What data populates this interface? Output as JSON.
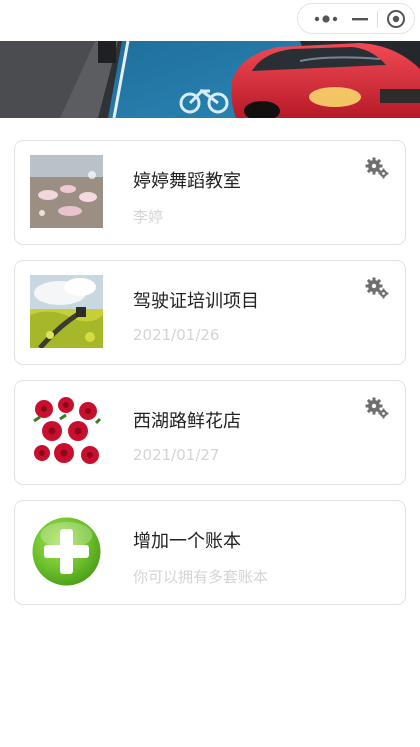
{
  "capsule": {
    "more_icon": "more-dots-icon",
    "minimize_icon": "minimize-icon",
    "close_icon": "target-close-icon"
  },
  "banner": {
    "description_icon": "street-car-photo"
  },
  "accounts": [
    {
      "title": "婷婷舞蹈教室",
      "subtitle": "李婷",
      "thumb_icon": "dance-class-photo",
      "settings_icon": "gears-icon"
    },
    {
      "title": "驾驶证培训项目",
      "subtitle": "2021/01/26",
      "thumb_icon": "train-field-photo",
      "settings_icon": "gears-icon"
    },
    {
      "title": "西湖路鲜花店",
      "subtitle": "2021/01/27",
      "thumb_icon": "roses-photo",
      "settings_icon": "gears-icon"
    }
  ],
  "add_book": {
    "title": "增加一个账本",
    "subtitle": "你可以拥有多套账本",
    "icon": "green-plus-icon"
  },
  "colors": {
    "border": "#e2e2e2",
    "title": "#222222",
    "subtitle": "#d4d4d4",
    "plus_green": "#6cc12b"
  }
}
